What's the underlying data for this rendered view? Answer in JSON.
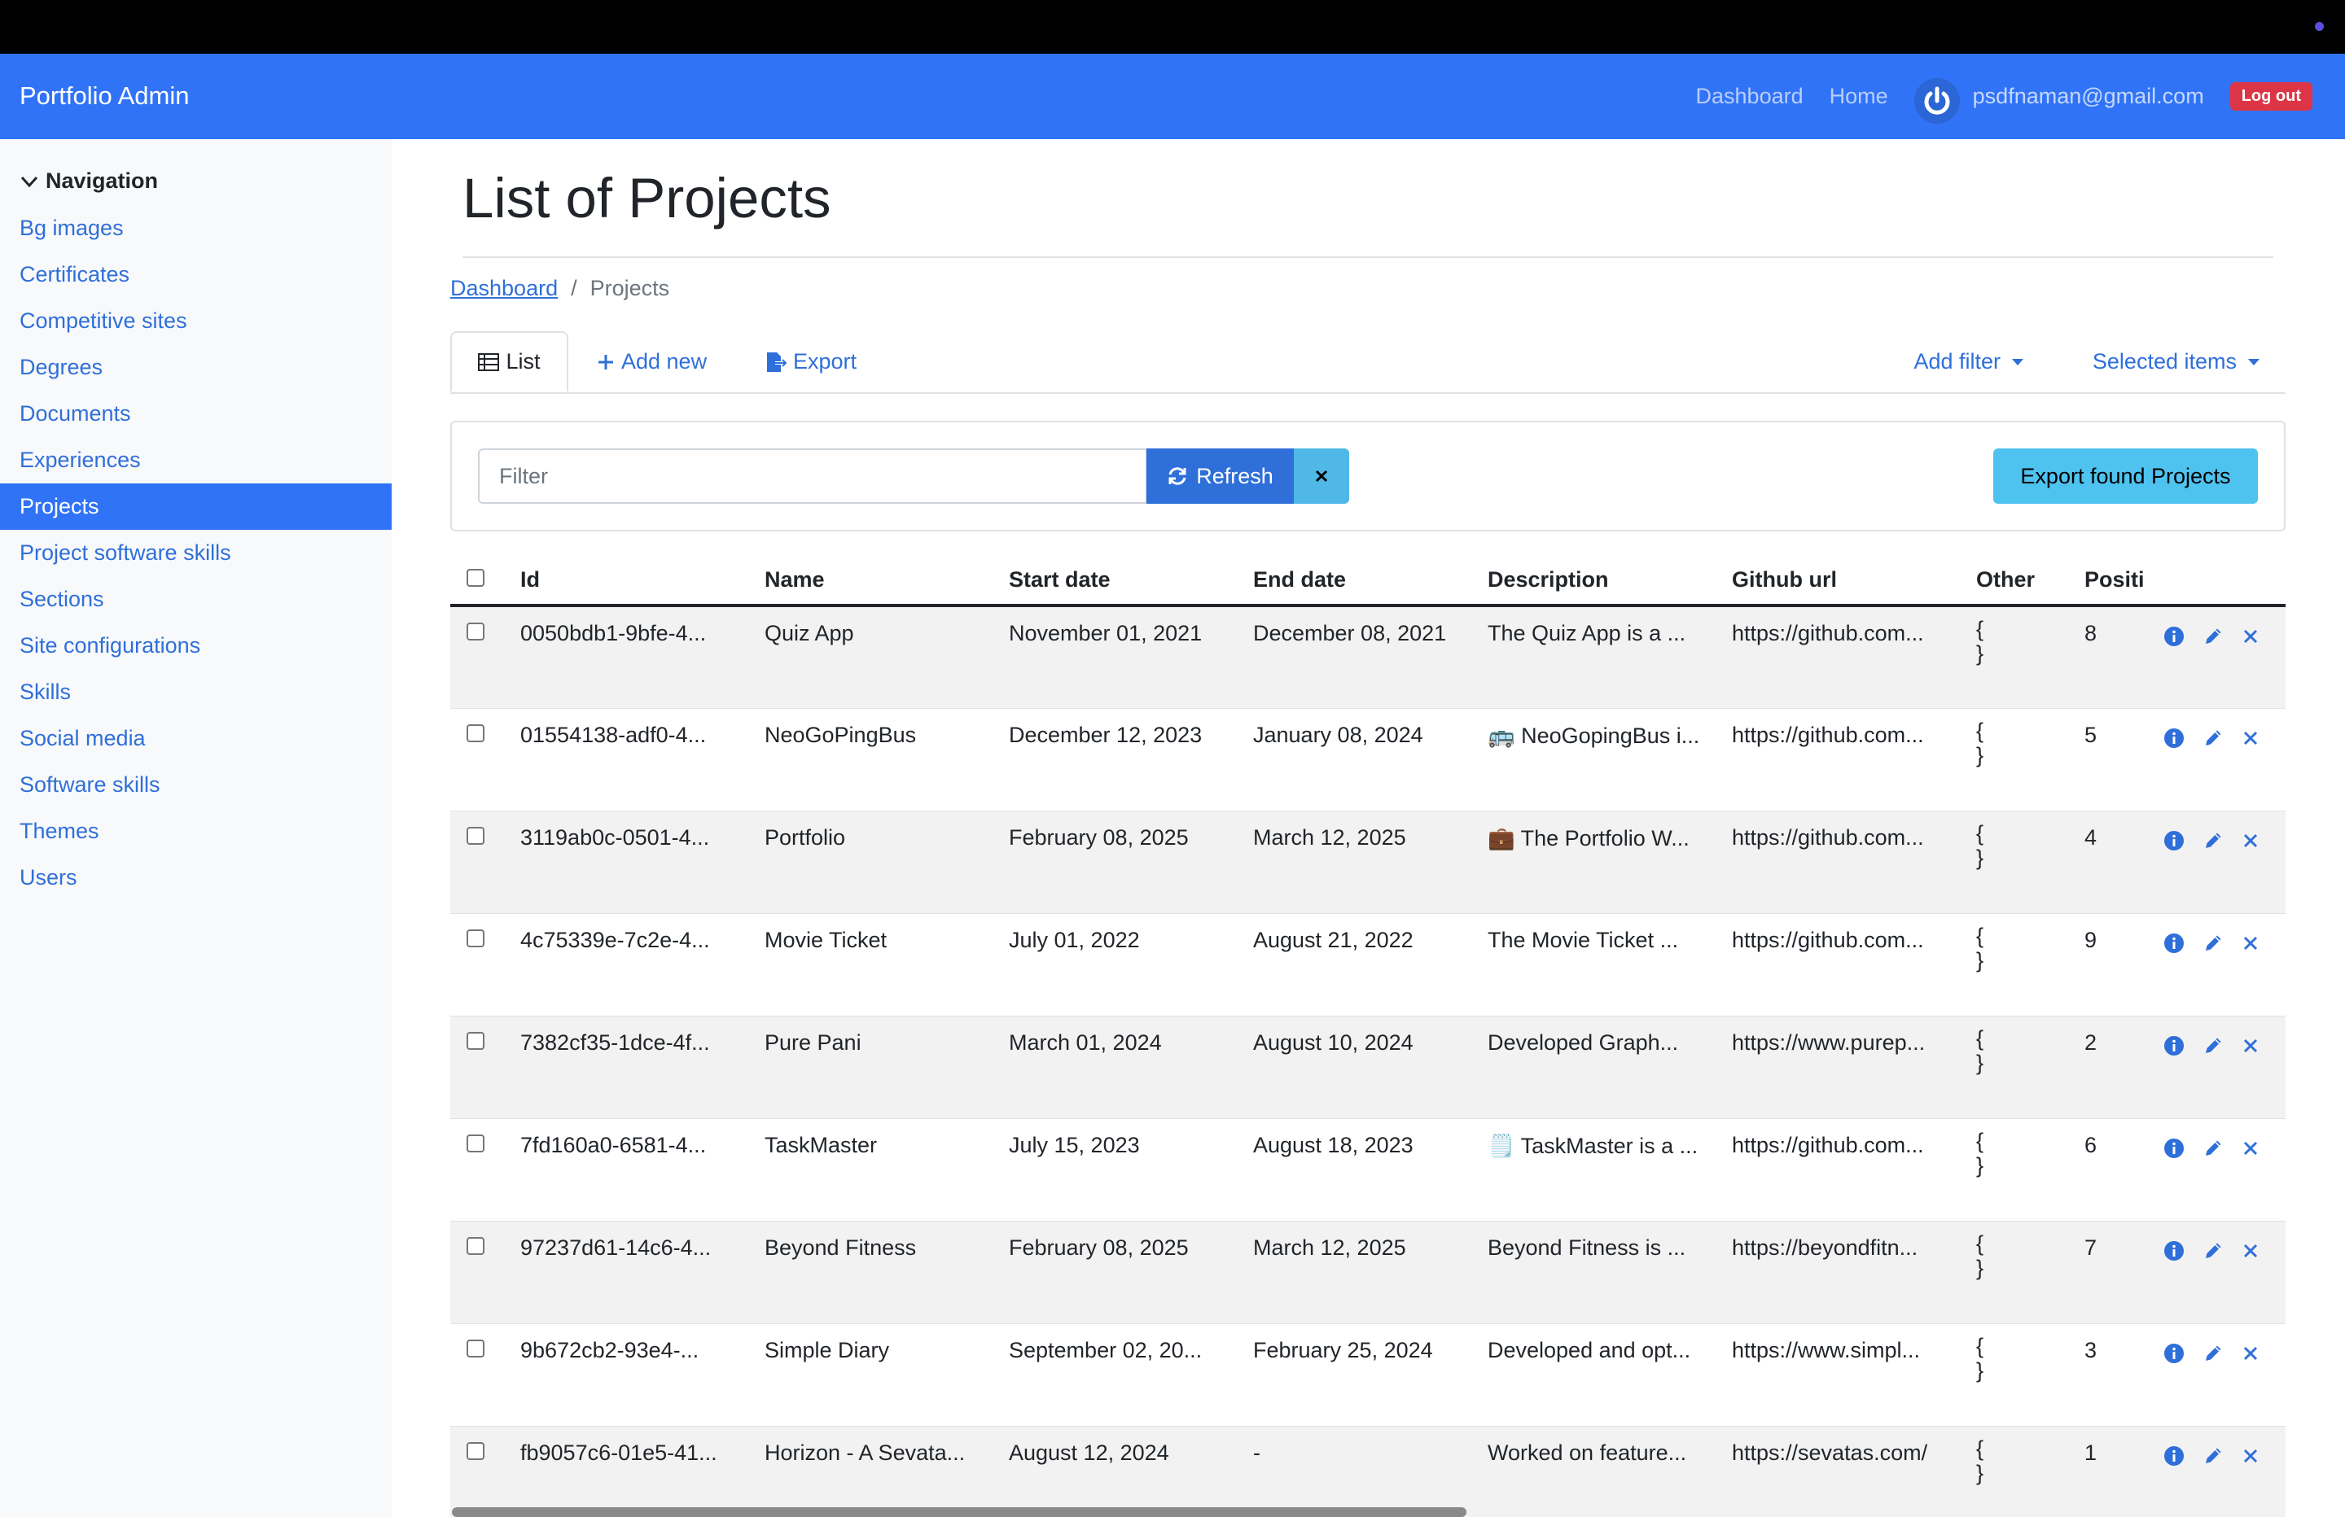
{
  "app": {
    "brand": "Portfolio Admin"
  },
  "navbar": {
    "links": [
      {
        "label": "Dashboard"
      },
      {
        "label": "Home"
      }
    ],
    "user_email": "psdfnaman@gmail.com",
    "logout_label": "Log out"
  },
  "sidebar": {
    "header": "Navigation",
    "items": [
      {
        "label": "Bg images"
      },
      {
        "label": "Certificates"
      },
      {
        "label": "Competitive sites"
      },
      {
        "label": "Degrees"
      },
      {
        "label": "Documents"
      },
      {
        "label": "Experiences"
      },
      {
        "label": "Projects",
        "active": true
      },
      {
        "label": "Project software skills"
      },
      {
        "label": "Sections"
      },
      {
        "label": "Site configurations"
      },
      {
        "label": "Skills"
      },
      {
        "label": "Social media"
      },
      {
        "label": "Software skills"
      },
      {
        "label": "Themes"
      },
      {
        "label": "Users"
      }
    ]
  },
  "page": {
    "title": "List of Projects",
    "breadcrumb": {
      "root": "Dashboard",
      "separator": "/",
      "current": "Projects"
    }
  },
  "tabs": {
    "list": "List",
    "add_new": "Add new",
    "export": "Export",
    "add_filter": "Add filter",
    "selected_items": "Selected items"
  },
  "filter": {
    "placeholder": "Filter",
    "value": "",
    "refresh_label": "Refresh",
    "export_found_label": "Export found Projects"
  },
  "table": {
    "columns": [
      "Id",
      "Name",
      "Start date",
      "End date",
      "Description",
      "Github url",
      "Other",
      "Positi"
    ],
    "rows": [
      {
        "id": "0050bdb1-9bfe-4...",
        "name": "Quiz App",
        "start": "November 01, 2021",
        "end": "December 08, 2021",
        "desc": "The Quiz App is a ...",
        "github": "https://github.com...",
        "other_open": "{",
        "other_close": "}",
        "position": "8"
      },
      {
        "id": "01554138-adf0-4...",
        "name": "NeoGoPingBus",
        "start": "December 12, 2023",
        "end": "January 08, 2024",
        "desc": "🚌 NeoGopingBus i...",
        "github": "https://github.com...",
        "other_open": "{",
        "other_close": "}",
        "position": "5"
      },
      {
        "id": "3119ab0c-0501-4...",
        "name": "Portfolio",
        "start": "February 08, 2025",
        "end": "March 12, 2025",
        "desc": "💼 The Portfolio W...",
        "github": "https://github.com...",
        "other_open": "{",
        "other_close": "}",
        "position": "4"
      },
      {
        "id": "4c75339e-7c2e-4...",
        "name": "Movie Ticket",
        "start": "July 01, 2022",
        "end": "August 21, 2022",
        "desc": "The Movie Ticket ...",
        "github": "https://github.com...",
        "other_open": "{",
        "other_close": "}",
        "position": "9"
      },
      {
        "id": "7382cf35-1dce-4f...",
        "name": "Pure Pani",
        "start": "March 01, 2024",
        "end": "August 10, 2024",
        "desc": "Developed Graph...",
        "github": "https://www.purep...",
        "other_open": "{",
        "other_close": "}",
        "position": "2"
      },
      {
        "id": "7fd160a0-6581-4...",
        "name": "TaskMaster",
        "start": "July 15, 2023",
        "end": "August 18, 2023",
        "desc": "🗒️ TaskMaster is a ...",
        "github": "https://github.com...",
        "other_open": "{",
        "other_close": "}",
        "position": "6"
      },
      {
        "id": "97237d61-14c6-4...",
        "name": "Beyond Fitness",
        "start": "February 08, 2025",
        "end": "March 12, 2025",
        "desc": "Beyond Fitness is ...",
        "github": "https://beyondfitn...",
        "other_open": "{",
        "other_close": "}",
        "position": "7"
      },
      {
        "id": "9b672cb2-93e4-...",
        "name": "Simple Diary",
        "start": "September 02, 20...",
        "end": "February 25, 2024",
        "desc": "Developed and opt...",
        "github": "https://www.simpl...",
        "other_open": "{",
        "other_close": "}",
        "position": "3"
      },
      {
        "id": "fb9057c6-01e5-41...",
        "name": "Horizon - A Sevata...",
        "start": "August 12, 2024",
        "end": "-",
        "desc": "Worked on feature...",
        "github": "https://sevatas.com/",
        "other_open": "{",
        "other_close": "}",
        "position": "1"
      }
    ]
  },
  "colors": {
    "navbar": "#3173f7",
    "link": "#2f6fd9",
    "logout": "#dc3545",
    "export_found": "#4fc3f0"
  }
}
